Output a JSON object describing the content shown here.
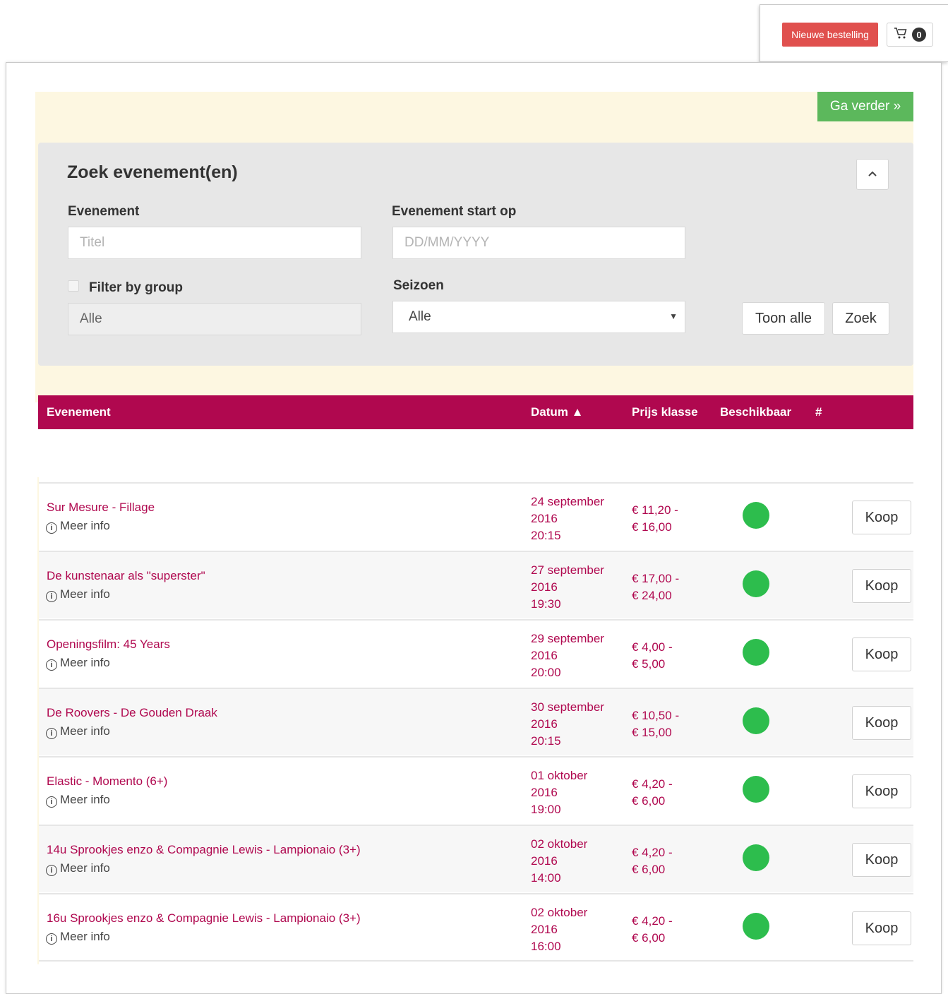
{
  "header": {
    "new_order_label": "Nieuwe bestelling",
    "cart_count": "0"
  },
  "toolbar": {
    "continue_label": "Ga verder »"
  },
  "search": {
    "title": "Zoek evenement(en)",
    "collapse_icon": "chevron-up-icon",
    "event_label": "Evenement",
    "event_placeholder": "Titel",
    "start_label": "Evenement start op",
    "start_placeholder": "DD/MM/YYYY",
    "group_label": "Filter by group",
    "group_value": "Alle",
    "season_label": "Seizoen",
    "season_value": "Alle",
    "show_all_label": "Toon alle",
    "search_label": "Zoek"
  },
  "table": {
    "header_color": "#b0084f",
    "columns": {
      "event": "Evenement",
      "date": "Datum ▲",
      "price": "Prijs klasse",
      "available": "Beschikbaar",
      "hash": "#"
    },
    "more_info_label": "Meer info",
    "buy_label": "Koop",
    "available_color": "#2dbd4d",
    "rows": [
      {
        "name": "Sur Mesure - Fillage",
        "date_day": "24 september",
        "date_year": "2016",
        "date_time": "20:15",
        "price_from": "€ 11,20 -",
        "price_to": "€ 16,00"
      },
      {
        "name": "De kunstenaar als \"superster\"",
        "date_day": "27 september",
        "date_year": "2016",
        "date_time": "19:30",
        "price_from": "€ 17,00 -",
        "price_to": "€ 24,00"
      },
      {
        "name": "Openingsfilm: 45 Years",
        "date_day": "29 september",
        "date_year": "2016",
        "date_time": "20:00",
        "price_from": "€ 4,00 -",
        "price_to": "€ 5,00"
      },
      {
        "name": "De Roovers - De Gouden Draak",
        "date_day": "30 september",
        "date_year": "2016",
        "date_time": "20:15",
        "price_from": "€ 10,50 -",
        "price_to": "€ 15,00"
      },
      {
        "name": "Elastic - Momento (6+)",
        "date_day": "01 oktober",
        "date_year": "2016",
        "date_time": "19:00",
        "price_from": "€ 4,20 -",
        "price_to": "€ 6,00"
      },
      {
        "name": "14u Sprookjes enzo & Compagnie Lewis - Lampionaio (3+)",
        "date_day": "02 oktober",
        "date_year": "2016",
        "date_time": "14:00",
        "price_from": "€ 4,20 -",
        "price_to": "€ 6,00"
      },
      {
        "name": "16u Sprookjes enzo & Compagnie Lewis - Lampionaio (3+)",
        "date_day": "02 oktober",
        "date_year": "2016",
        "date_time": "16:00",
        "price_from": "€ 4,20 -",
        "price_to": "€ 6,00"
      }
    ]
  }
}
